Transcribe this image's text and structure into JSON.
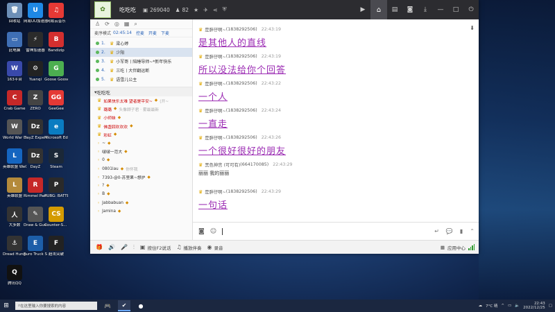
{
  "desktop_icons": [
    {
      "label": "回收站",
      "color": "#6d8fb7",
      "glyph": "🗑"
    },
    {
      "label": "网易UU加速器",
      "color": "#1e88e5",
      "glyph": "U"
    },
    {
      "label": "网易云音乐",
      "color": "#e53935",
      "glyph": "♫"
    },
    {
      "label": "此电脑",
      "color": "#3f6fb5",
      "glyph": "▭"
    },
    {
      "label": "雷神加速器",
      "color": "#2b2b2b",
      "glyph": "⚡"
    },
    {
      "label": "Bandizip",
      "color": "#d32f2f",
      "glyph": "B"
    },
    {
      "label": "163平台",
      "color": "#3949ab",
      "glyph": "W"
    },
    {
      "label": "Yuanqi",
      "color": "#222",
      "glyph": "⚙"
    },
    {
      "label": "Goose Goose Duck",
      "color": "#4caf50",
      "glyph": "G"
    },
    {
      "label": "Crab Game",
      "color": "#c62828",
      "glyph": "C"
    },
    {
      "label": "ZERO",
      "color": "#444",
      "glyph": "Z"
    },
    {
      "label": "GeeGee",
      "color": "#e53935",
      "glyph": "GG"
    },
    {
      "label": "World War Heroes",
      "color": "#555",
      "glyph": "W"
    },
    {
      "label": "DayZ Experimen...",
      "color": "#333",
      "glyph": "Dz"
    },
    {
      "label": "Microsoft Edge",
      "color": "#0a7cc1",
      "glyph": "e"
    },
    {
      "label": "英雄联盟 WeGame版",
      "color": "#1565c0",
      "glyph": "L"
    },
    {
      "label": "DayZ",
      "color": "#333",
      "glyph": "Dz"
    },
    {
      "label": "Steam",
      "color": "#1b2838",
      "glyph": "S"
    },
    {
      "label": "英雄联盟",
      "color": "#b48a3b",
      "glyph": "L"
    },
    {
      "label": "Rimmel Party",
      "color": "#c62828",
      "glyph": "R"
    },
    {
      "label": "PUBG: BATTLEGR...",
      "color": "#2a2a2a",
      "glyph": "P"
    },
    {
      "label": "大多数",
      "color": "#333",
      "glyph": "人"
    },
    {
      "label": "Draw & Guess",
      "color": "#555",
      "glyph": "✎"
    },
    {
      "label": "Counter-S... Global Offe...",
      "color": "#d49b00",
      "glyph": "CS"
    },
    {
      "label": "Dread Hunger",
      "color": "#333",
      "glyph": "⚓"
    },
    {
      "label": "Euro Truck Simulator 2",
      "color": "#1d5ea8",
      "glyph": "E"
    },
    {
      "label": "超击突破",
      "color": "#222",
      "glyph": "F"
    },
    {
      "label": "腾讯QQ",
      "color": "#111",
      "glyph": "Q"
    }
  ],
  "app": {
    "room_name": "吃吃吃",
    "room_id": "269040",
    "member_count": "82",
    "left": {
      "mode_label": "麦序模式",
      "timer": "02:45:14",
      "link_control": "控麦",
      "link_open": "开麦",
      "link_down": "下麦",
      "queue": [
        {
          "num": "1.",
          "name": "梁心婷",
          "selected": false
        },
        {
          "num": "2.",
          "name": "少阳",
          "selected": true
        },
        {
          "num": "3.",
          "name": "小军哥丨陪睡导师~*新年快乐",
          "selected": false
        },
        {
          "num": "4.",
          "name": "三吃丨大伴翻运断",
          "selected": false
        },
        {
          "num": "5.",
          "name": "语雪儿公主",
          "selected": false
        }
      ],
      "channel_name": "吃吃吃",
      "members": [
        {
          "name": "如果快乐太难 望者是平安~",
          "extra": "(开~",
          "style": "red"
        },
        {
          "name": "璐璐",
          "extra": "头像顾子君 · 雾最最新",
          "style": "red"
        },
        {
          "name": "小师妹",
          "extra": "",
          "style": "red"
        },
        {
          "name": "佛盏囧欢欢欢",
          "extra": "",
          "style": "red"
        },
        {
          "name": "彩虹",
          "extra": "",
          "style": "red"
        },
        {
          "name": "~",
          "extra": "",
          "style": "blue"
        },
        {
          "name": "啵啵一范大",
          "extra": "",
          "style": "blue"
        },
        {
          "name": "0",
          "extra": "",
          "style": "blue"
        },
        {
          "name": "0801lau",
          "extra": "你怀我",
          "style": "blue"
        },
        {
          "name": "7393-@0-苏里果~想护",
          "extra": "",
          "style": "blue"
        },
        {
          "name": "?",
          "extra": "",
          "style": "blue"
        },
        {
          "name": "B",
          "extra": "",
          "style": "blue"
        },
        {
          "name": "Jabbabuan",
          "extra": "",
          "style": "blue"
        },
        {
          "name": "Jamina",
          "extra": "",
          "style": "blue"
        }
      ]
    },
    "messages": [
      {
        "name": "是胖仔啊~",
        "id": "(1838292506)",
        "time": "22:43:19",
        "text": "是其他人的直线",
        "style": "art"
      },
      {
        "name": "是胖仔啊~",
        "id": "(1838292506)",
        "time": "22:43:19",
        "text": "所以没法给你个回答",
        "style": "art"
      },
      {
        "name": "是胖仔啊~",
        "id": "(1838292506)",
        "time": "22:43:22",
        "text": "一个人",
        "style": "art"
      },
      {
        "name": "是胖仔啊~",
        "id": "(1838292506)",
        "time": "22:43:24",
        "text": "一直走",
        "style": "art"
      },
      {
        "name": "是胖仔啊~",
        "id": "(1838292506)",
        "time": "22:43:26",
        "text": "一个很好很好的朋友",
        "style": "art"
      },
      {
        "name": "黑色神宫 (可可有)",
        "id": "(664170085)",
        "time": "22:43:29",
        "text": "丽丽    我的丽丽",
        "style": "plain"
      },
      {
        "name": "是胖仔啊~",
        "id": "(1838292506)",
        "time": "22:43:29",
        "text": "一句话",
        "style": "art"
      }
    ],
    "bottom_bar": {
      "hotkey_label": "按住F2说话",
      "music_label": "播放伴奏",
      "record_label": "录音",
      "app_center_label": "应用中心"
    }
  },
  "taskbar": {
    "search_placeholder": "在这里输入你要搜索的内容",
    "weather": "7°C 晴",
    "time": "22:43",
    "date": "2022/12/25"
  },
  "colors": {
    "accent": "#2a64b8",
    "message_art": "#9b2bb3",
    "topbar": "#2c2c30"
  }
}
